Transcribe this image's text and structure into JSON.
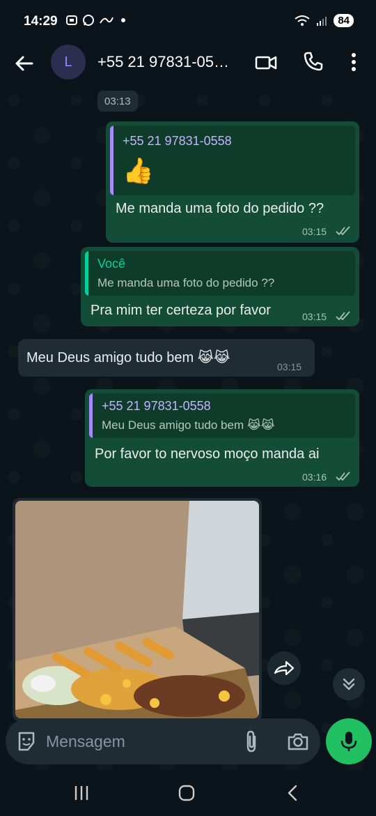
{
  "status_bar": {
    "time": "14:29",
    "battery": "84"
  },
  "header": {
    "avatar_letter": "L",
    "contact_name": "+55 21 97831-05…"
  },
  "chat": {
    "date_pill": "03:13",
    "messages": [
      {
        "direction": "out",
        "quote_author": "+55 21 97831-0558",
        "quote_emoji": "👍",
        "text": "Me manda uma foto do pedido ??",
        "time": "03:15",
        "status": "read"
      },
      {
        "direction": "out",
        "quote_author": "Você",
        "quote_text": "Me manda uma foto do pedido ??",
        "text": "Pra mim ter certeza por favor",
        "time": "03:15",
        "status": "read"
      },
      {
        "direction": "in",
        "text": "Meu Deus amigo tudo bem 😹😹",
        "time": "03:15"
      },
      {
        "direction": "out",
        "quote_author": "+55 21 97831-0558",
        "quote_text": "Meu Deus amigo tudo bem 😹😹",
        "text": "Por favor to nervoso moço manda ai",
        "time": "03:16",
        "status": "read"
      }
    ]
  },
  "input": {
    "placeholder": "Mensagem"
  },
  "colors": {
    "accent": "#21c063",
    "outgoing_bubble": "#144d37",
    "incoming_bubble": "#1f2c34",
    "background": "#0b141a"
  }
}
